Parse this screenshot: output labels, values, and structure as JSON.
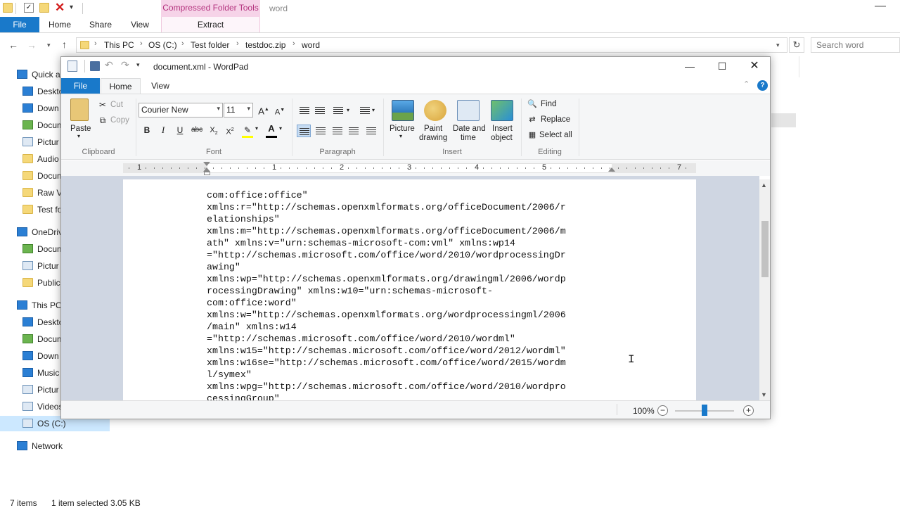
{
  "explorer": {
    "contextual_tab_group": "Compressed Folder Tools",
    "window_title": "word",
    "tabs": [
      "File",
      "Home",
      "Share",
      "View"
    ],
    "contextual_tab": "Extract",
    "breadcrumb": [
      "This PC",
      "OS (C:)",
      "Test folder",
      "testdoc.zip",
      "word"
    ],
    "search_placeholder": "Search word",
    "nav": [
      {
        "label": "Quick a",
        "icon": "star-icon",
        "top": true
      },
      {
        "label": "Deskto",
        "icon": "desktop-icon"
      },
      {
        "label": "Down",
        "icon": "download-icon"
      },
      {
        "label": "Docum",
        "icon": "documents-icon"
      },
      {
        "label": "Pictur",
        "icon": "pictures-icon"
      },
      {
        "label": "Audio",
        "icon": "folder-icon"
      },
      {
        "label": "Docum",
        "icon": "folder-icon"
      },
      {
        "label": "Raw V",
        "icon": "folder-icon"
      },
      {
        "label": "Test fo",
        "icon": "folder-icon"
      },
      {
        "label": "OneDriv",
        "icon": "cloud-icon",
        "top": true
      },
      {
        "label": "Docum",
        "icon": "documents-icon"
      },
      {
        "label": "Pictur",
        "icon": "pictures-icon"
      },
      {
        "label": "Public",
        "icon": "public-icon"
      },
      {
        "label": "This PC",
        "icon": "computer-icon",
        "top": true
      },
      {
        "label": "Deskto",
        "icon": "desktop-icon"
      },
      {
        "label": "Docum",
        "icon": "documents-icon"
      },
      {
        "label": "Down",
        "icon": "download-icon"
      },
      {
        "label": "Music",
        "icon": "music-icon"
      },
      {
        "label": "Pictur",
        "icon": "pictures-icon"
      },
      {
        "label": "Videos",
        "icon": "videos-icon"
      },
      {
        "label": "OS (C:)",
        "icon": "drive-icon",
        "selected": true
      },
      {
        "label": "Network",
        "icon": "network-icon",
        "top": true
      }
    ],
    "status_items": "7 items",
    "status_selected": "1 item selected  3.05 KB"
  },
  "wordpad": {
    "title": "document.xml - WordPad",
    "tabs": [
      "File",
      "Home",
      "View"
    ],
    "clipboard": {
      "paste": "Paste",
      "cut": "Cut",
      "copy": "Copy",
      "group": "Clipboard"
    },
    "font": {
      "family": "Courier New",
      "size": "11",
      "group": "Font"
    },
    "paragraph_group": "Paragraph",
    "insert": {
      "picture": "Picture",
      "paint1": "Paint",
      "paint2": "drawing",
      "date1": "Date and",
      "date2": "time",
      "obj1": "Insert",
      "obj2": "object",
      "group": "Insert"
    },
    "editing": {
      "find": "Find",
      "replace": "Replace",
      "select_all": "Select all",
      "group": "Editing"
    },
    "ruler_numbers": [
      "1",
      "1",
      "2",
      "3",
      "4",
      "5",
      "7"
    ],
    "document_lines": [
      "com:office:office\"",
      "xmlns:r=\"http://schemas.openxmlformats.org/officeDocument/2006/r",
      "elationships\"",
      "xmlns:m=\"http://schemas.openxmlformats.org/officeDocument/2006/m",
      "ath\" xmlns:v=\"urn:schemas-microsoft-com:vml\" xmlns:wp14",
      "=\"http://schemas.microsoft.com/office/word/2010/wordprocessingDr",
      "awing\"",
      "xmlns:wp=\"http://schemas.openxmlformats.org/drawingml/2006/wordp",
      "rocessingDrawing\" xmlns:w10=\"urn:schemas-microsoft-",
      "com:office:word\"",
      "xmlns:w=\"http://schemas.openxmlformats.org/wordprocessingml/2006",
      "/main\" xmlns:w14",
      "=\"http://schemas.microsoft.com/office/word/2010/wordml\"",
      "xmlns:w15=\"http://schemas.microsoft.com/office/word/2012/wordml\"",
      "xmlns:w16se=\"http://schemas.microsoft.com/office/word/2015/wordm",
      "l/symex\"",
      "xmlns:wpg=\"http://schemas.microsoft.com/office/word/2010/wordpro",
      "cessingGroup\""
    ],
    "zoom": "100%"
  }
}
